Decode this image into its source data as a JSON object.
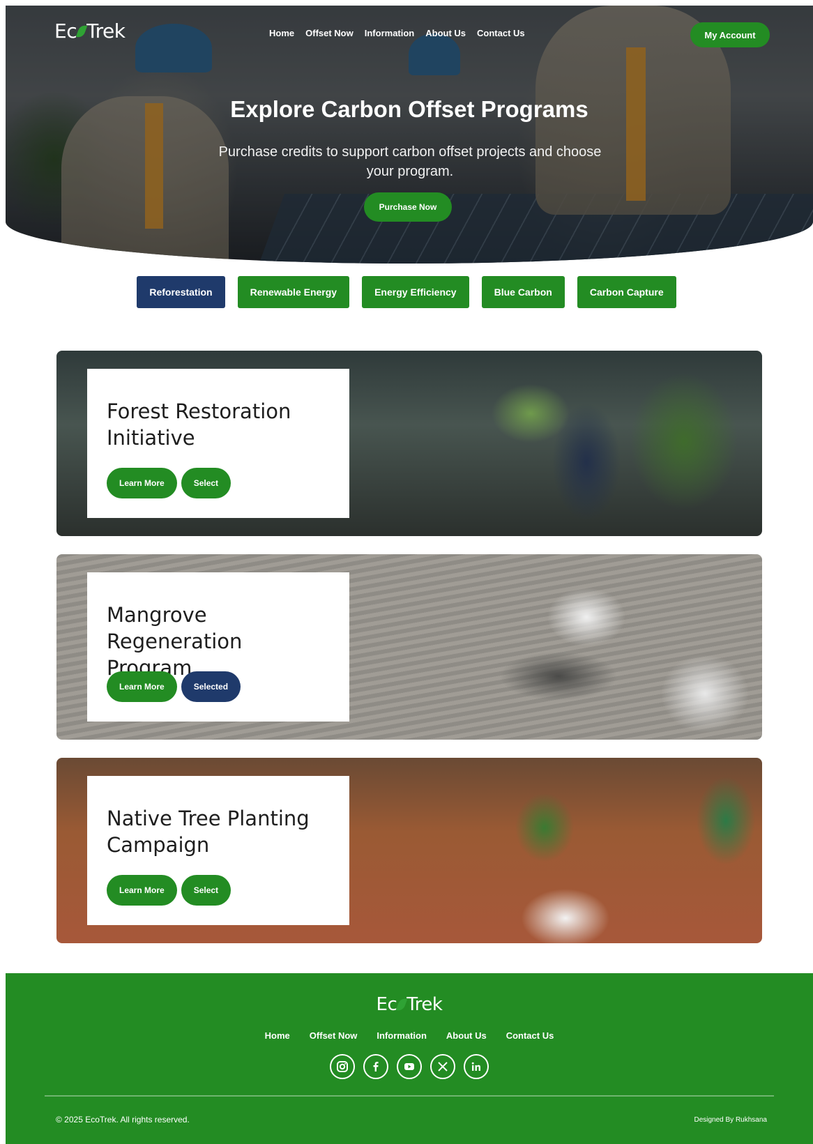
{
  "brand": {
    "logo_left": "Ec",
    "logo_right": "Trek"
  },
  "nav": {
    "items": [
      "Home",
      "Offset Now",
      "Information",
      "About Us",
      "Contact Us"
    ],
    "account_label": "My Account"
  },
  "hero": {
    "title": "Explore Carbon Offset Programs",
    "subtitle": "Purchase credits to support carbon offset projects and choose your program.",
    "cta_label": "Purchase Now"
  },
  "categories": [
    {
      "label": "Reforestation",
      "active": true
    },
    {
      "label": "Renewable Energy",
      "active": false
    },
    {
      "label": "Energy Efficiency",
      "active": false
    },
    {
      "label": "Blue Carbon",
      "active": false
    },
    {
      "label": "Carbon Capture",
      "active": false
    }
  ],
  "programs": [
    {
      "title": "Forest Restoration Initiative",
      "learn_label": "Learn More",
      "select_label": "Select",
      "selected": false
    },
    {
      "title": "Mangrove Regeneration Program",
      "learn_label": "Learn More",
      "select_label": "Selected",
      "selected": true
    },
    {
      "title": "Native Tree Planting Campaign",
      "learn_label": "Learn More",
      "select_label": "Select",
      "selected": false
    }
  ],
  "footer": {
    "nav": [
      "Home",
      "Offset Now",
      "Information",
      "About Us",
      "Contact Us"
    ],
    "socials": [
      "instagram-icon",
      "facebook-icon",
      "youtube-icon",
      "x-icon",
      "linkedin-icon"
    ],
    "copyright": "© 2025 EcoTrek. All rights reserved.",
    "designer": "Designed By Rukhsana"
  },
  "colors": {
    "primary_green": "#238c23",
    "navy": "#1f3a6b"
  }
}
